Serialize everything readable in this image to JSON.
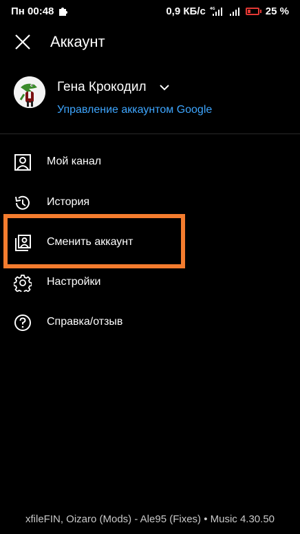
{
  "status_bar": {
    "day_time": "Пн 00:48",
    "speed": "0,9 КБ/с",
    "network_type": "4G",
    "battery_percent": "25 %",
    "battery_color": "#e53935"
  },
  "header": {
    "title": "Аккаунт",
    "close_icon": "close-icon"
  },
  "account": {
    "name": "Гена Крокодил",
    "manage_label": "Управление аккаунтом Google",
    "link_color": "#3ea6ff"
  },
  "menu": {
    "items": [
      {
        "label": "Мой канал",
        "icon": "person-box-icon"
      },
      {
        "label": "История",
        "icon": "history-icon"
      },
      {
        "label": "Сменить аккаунт",
        "icon": "switch-account-icon"
      },
      {
        "label": "Настройки",
        "icon": "gear-icon"
      },
      {
        "label": "Справка/отзыв",
        "icon": "help-icon"
      }
    ],
    "highlight_color": "#f47c2e"
  },
  "footer": {
    "credits": "xfileFIN, Oizaro (Mods) - Ale95 (Fixes)  •  Music 4.30.50"
  }
}
